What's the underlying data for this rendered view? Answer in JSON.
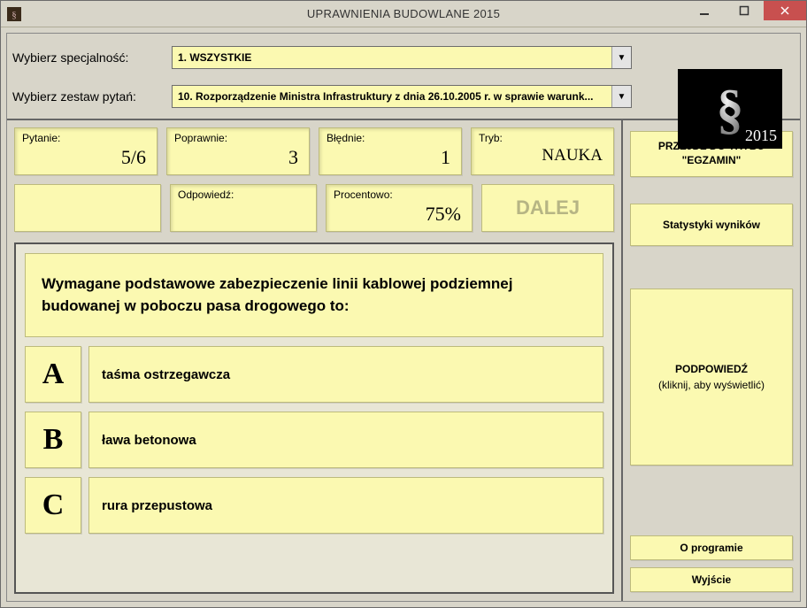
{
  "window": {
    "title": "UPRAWNIENIA BUDOWLANE 2015",
    "logo_year": "2015"
  },
  "selectors": {
    "speciality_label": "Wybierz specjalność:",
    "speciality_value": "1. WSZYSTKIE",
    "question_set_label": "Wybierz zestaw pytań:",
    "question_set_value": "10. Rozporządzenie Ministra Infrastruktury z dnia 26.10.2005 r. w sprawie warunk..."
  },
  "stats": {
    "question_label": "Pytanie:",
    "question_value": "5/6",
    "correct_label": "Poprawnie:",
    "correct_value": "3",
    "wrong_label": "Błędnie:",
    "wrong_value": "1",
    "mode_label": "Tryb:",
    "mode_value": "NAUKA",
    "answer_label": "Odpowiedź:",
    "answer_value": "",
    "percent_label": "Procentowo:",
    "percent_value": "75%",
    "next_label": "DALEJ"
  },
  "question": {
    "text": "Wymagane podstawowe zabezpieczenie linii kablowej podziemnej budowanej w poboczu pasa drogowego to:",
    "answers": [
      {
        "letter": "A",
        "text": "taśma ostrzegawcza"
      },
      {
        "letter": "B",
        "text": "ława betonowa"
      },
      {
        "letter": "C",
        "text": "rura przepustowa"
      }
    ]
  },
  "sidebar": {
    "exam_mode": "PRZEJDŹ DO TRYBU \"EGZAMIN\"",
    "stats_btn": "Statystyki wyników",
    "hint_label": "PODPOWIEDŹ",
    "hint_sub": "(kliknij, aby wyświetlić)",
    "about": "O programie",
    "exit": "Wyjście"
  }
}
